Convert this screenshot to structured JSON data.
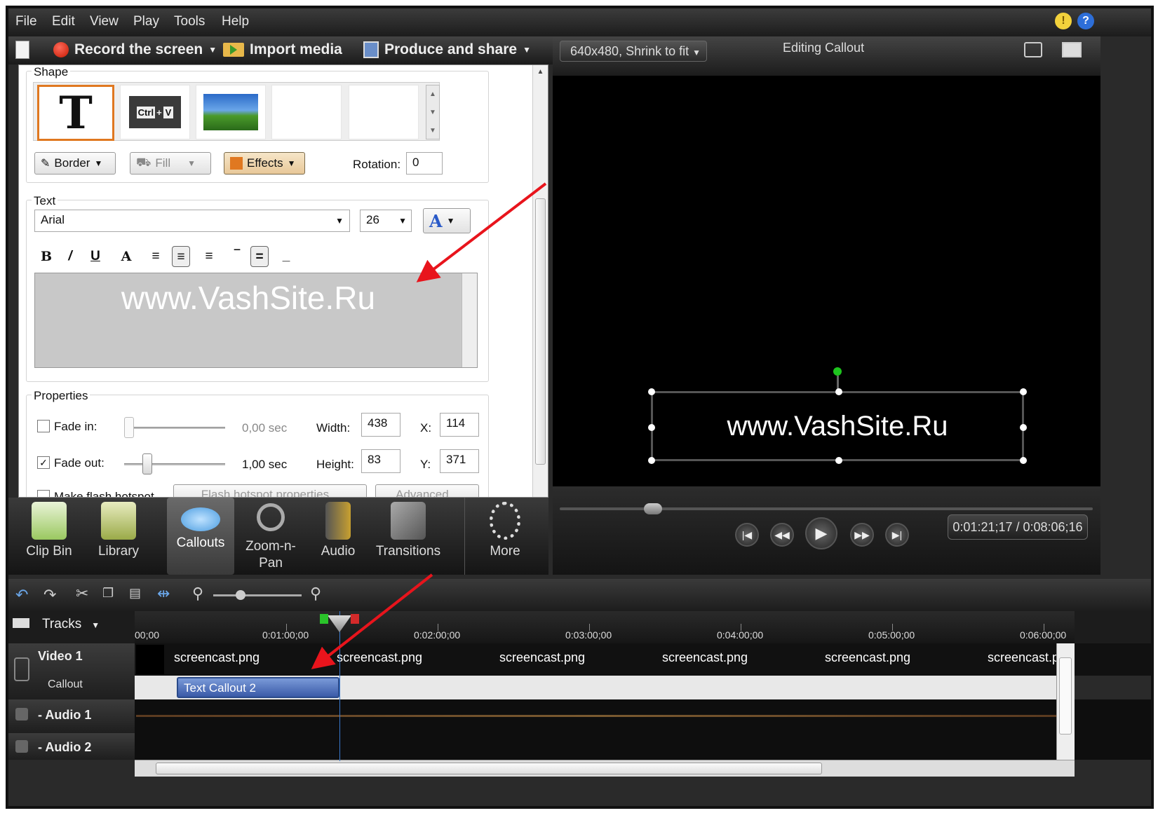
{
  "menu": {
    "file": "File",
    "edit": "Edit",
    "view": "View",
    "play": "Play",
    "tools": "Tools",
    "help": "Help"
  },
  "toolbar": {
    "record": "Record the screen",
    "import": "Import media",
    "produce": "Produce and share"
  },
  "shape": {
    "label": "Shape",
    "border": "Border",
    "fill": "Fill",
    "effects": "Effects",
    "rotation_label": "Rotation:",
    "rotation": "0",
    "t_glyph": "T",
    "ctrl": "Ctrl",
    "plus": "+",
    "v": "V"
  },
  "text": {
    "label": "Text",
    "font": "Arial",
    "size": "26",
    "color_glyph": "A",
    "content": "www.VashSite.Ru"
  },
  "format": {
    "bold": "B",
    "italic": "/",
    "underline": "U",
    "font_a": "A"
  },
  "properties": {
    "label": "Properties",
    "fade_in": "Fade in:",
    "fade_in_val": "0,00 sec",
    "fade_out": "Fade out:",
    "fade_out_val": "1,00 sec",
    "width_label": "Width:",
    "width": "438",
    "height_label": "Height:",
    "height": "83",
    "x_label": "X:",
    "x": "114",
    "y_label": "Y:",
    "y": "371",
    "flash": "Make flash hotspot",
    "flash_props": "Flash hotspot properties...",
    "advanced": "Advanced..."
  },
  "tabs": [
    "Clip Bin",
    "Library",
    "Callouts",
    "Zoom-n-\nPan",
    "Audio",
    "Transitions",
    "More"
  ],
  "preview": {
    "size": "640x480, Shrink to fit",
    "title": "Editing Callout",
    "text": "www.VashSite.Ru",
    "time": "0:01:21;17 / 0:08:06;16"
  },
  "timeline": {
    "tracks": "Tracks",
    "ruler": [
      "00;00",
      "0:01:00;00",
      "0:02:00;00",
      "0:03:00;00",
      "0:04:00;00",
      "0:05:00;00",
      "0:06:00;00"
    ],
    "video": "Video 1",
    "callout": "Callout",
    "audio1": "Audio 1",
    "audio2": "Audio 2",
    "clips": [
      "screencast.png",
      "screencast.png",
      "screencast.png",
      "screencast.png",
      "screencast.png",
      "screencast.pn"
    ],
    "callout_clip": "Text Callout 2"
  },
  "colors": {
    "accent": "#e07820",
    "arrow": "#e8141c"
  }
}
